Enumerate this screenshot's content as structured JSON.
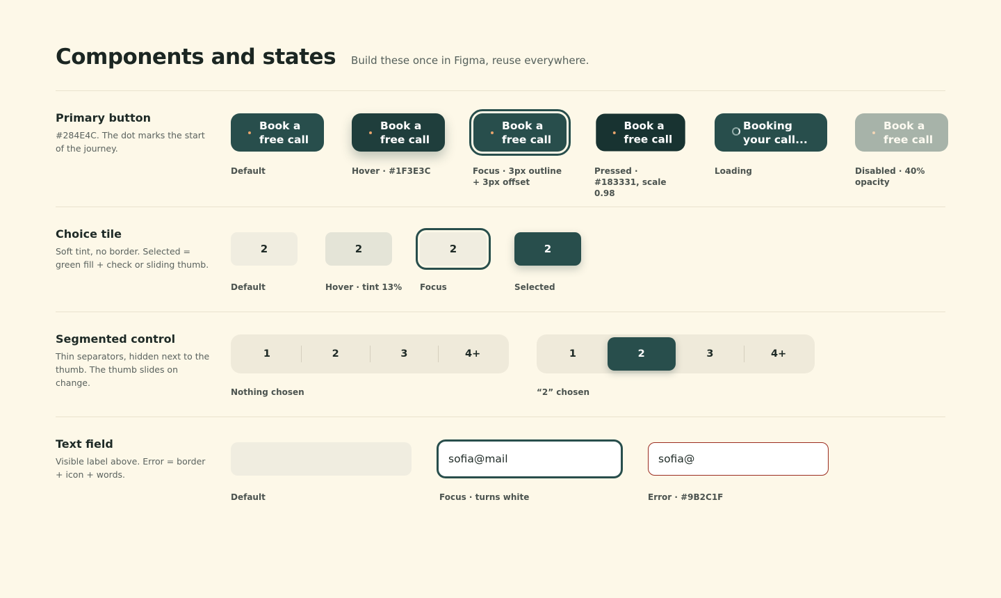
{
  "header": {
    "title": "Components and states",
    "subtitle": "Build these once in Figma, reuse everywhere."
  },
  "colors": {
    "background": "#FDF8E8",
    "primary": "#284E4C",
    "hover": "#1F3E3C",
    "pressed": "#183331",
    "error": "#9B2C1F",
    "dot": "#E8A46C",
    "tint": "#F0EDE0"
  },
  "primary_button": {
    "title": "Primary button",
    "description": "#284E4C. The dot marks the start of the journey.",
    "states": [
      {
        "button_label": "Book a\nfree call",
        "caption": "Default"
      },
      {
        "button_label": "Book a\nfree call",
        "caption": "Hover · #1F3E3C"
      },
      {
        "button_label": "Book a\nfree call",
        "caption": "Focus · 3px outline + 3px offset"
      },
      {
        "button_label": "Book a\nfree call",
        "caption": "Pressed · #183331, scale 0.98"
      },
      {
        "button_label": "Booking\nyour call...",
        "caption": "Loading",
        "icon": "spinner-icon"
      },
      {
        "button_label": "Book a\nfree call",
        "caption": "Disabled · 40% opacity"
      }
    ]
  },
  "choice_tile": {
    "title": "Choice tile",
    "description": "Soft tint, no border. Selected = green fill + check or sliding thumb.",
    "states": [
      {
        "value": "2",
        "caption": "Default"
      },
      {
        "value": "2",
        "caption": "Hover · tint 13%"
      },
      {
        "value": "2",
        "caption": "Focus"
      },
      {
        "value": "2",
        "caption": "Selected"
      }
    ]
  },
  "segmented_control": {
    "title": "Segmented control",
    "description": "Thin separators, hidden next to the thumb. The thumb slides on change.",
    "options": [
      "1",
      "2",
      "3",
      "4+"
    ],
    "states": [
      {
        "caption": "Nothing chosen",
        "selected": null
      },
      {
        "caption": "“2” chosen",
        "selected": "2"
      }
    ]
  },
  "text_field": {
    "title": "Text field",
    "description": "Visible label above. Error = border + icon + words.",
    "states": [
      {
        "value": "",
        "caption": "Default"
      },
      {
        "value": "sofia@mail",
        "caption": "Focus · turns white"
      },
      {
        "value": "sofia@",
        "caption": "Error · #9B2C1F"
      }
    ]
  }
}
